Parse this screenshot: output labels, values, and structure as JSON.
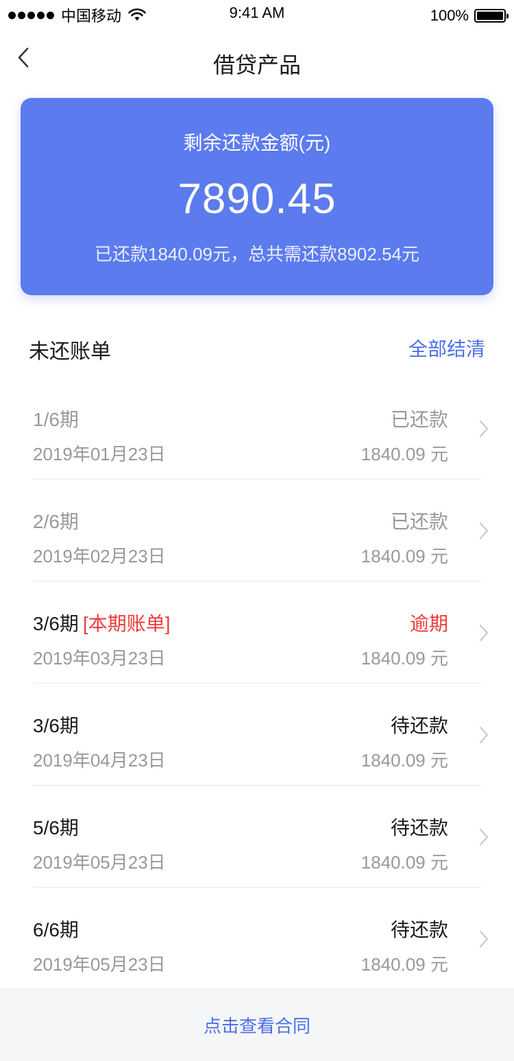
{
  "status_bar": {
    "carrier": "中国移动",
    "time": "9:41 AM",
    "battery": "100%"
  },
  "nav": {
    "title": "借贷产品",
    "back_icon": "chevron-left-icon"
  },
  "summary": {
    "label": "剩余还款金额(元)",
    "amount": "7890.45",
    "detail": "已还款1840.09元，总共需还款8902.54元"
  },
  "section": {
    "title": "未还账单",
    "settle_all": "全部结清"
  },
  "bills": [
    {
      "period": "1/6期",
      "tag": "",
      "date": "2019年01月23日",
      "status": "已还款",
      "amount": "1840.09 元",
      "state": "paid"
    },
    {
      "period": "2/6期",
      "tag": "",
      "date": "2019年02月23日",
      "status": "已还款",
      "amount": "1840.09 元",
      "state": "paid"
    },
    {
      "period": "3/6期",
      "tag": "[本期账单]",
      "date": "2019年03月23日",
      "status": "逾期",
      "amount": "1840.09 元",
      "state": "overdue"
    },
    {
      "period": "3/6期",
      "tag": "",
      "date": "2019年04月23日",
      "status": "待还款",
      "amount": "1840.09 元",
      "state": "pending"
    },
    {
      "period": "5/6期",
      "tag": "",
      "date": "2019年05月23日",
      "status": "待还款",
      "amount": "1840.09 元",
      "state": "pending"
    },
    {
      "period": "6/6期",
      "tag": "",
      "date": "2019年05月23日",
      "status": "待还款",
      "amount": "1840.09 元",
      "state": "pending"
    }
  ],
  "footer": {
    "view_contract": "点击查看合同"
  },
  "colors": {
    "card_bg": "#5b7bef",
    "link": "#4a6fe8",
    "overdue": "#f03b3b",
    "muted": "#999999"
  }
}
